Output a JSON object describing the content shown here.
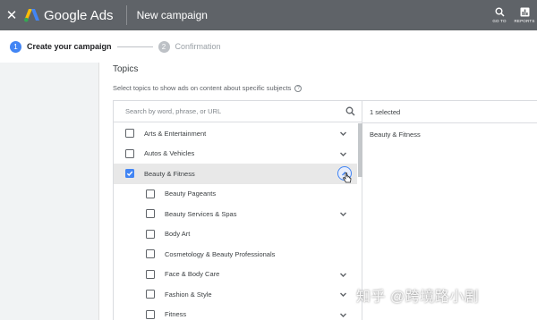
{
  "topbar": {
    "close_icon": "close-icon",
    "brand": "Google Ads",
    "page_title": "New campaign",
    "actions": [
      {
        "icon": "search-icon",
        "label": "GO TO"
      },
      {
        "icon": "bar-chart-icon",
        "label": "REPORTS"
      }
    ]
  },
  "stepper": {
    "steps": [
      {
        "number": "1",
        "label": "Create your campaign",
        "active": true
      },
      {
        "number": "2",
        "label": "Confirmation",
        "active": false
      }
    ]
  },
  "topics": {
    "title": "Topics",
    "description": "Select topics to show ads on content about specific subjects",
    "search_placeholder": "Search by word, phrase, or URL",
    "items": [
      {
        "label": "Arts & Entertainment",
        "checked": false,
        "expandable": true,
        "level": 0
      },
      {
        "label": "Autos & Vehicles",
        "checked": false,
        "expandable": true,
        "level": 0
      },
      {
        "label": "Beauty & Fitness",
        "checked": true,
        "expandable": true,
        "level": 0,
        "expanded": true
      },
      {
        "label": "Beauty Pageants",
        "checked": false,
        "expandable": false,
        "level": 1
      },
      {
        "label": "Beauty Services & Spas",
        "checked": false,
        "expandable": true,
        "level": 1
      },
      {
        "label": "Body Art",
        "checked": false,
        "expandable": false,
        "level": 1
      },
      {
        "label": "Cosmetology & Beauty Professionals",
        "checked": false,
        "expandable": false,
        "level": 1
      },
      {
        "label": "Face & Body Care",
        "checked": false,
        "expandable": true,
        "level": 1
      },
      {
        "label": "Fashion & Style",
        "checked": false,
        "expandable": true,
        "level": 1
      },
      {
        "label": "Fitness",
        "checked": false,
        "expandable": true,
        "level": 1
      }
    ],
    "selected_count": "1 selected",
    "selected_items": [
      "Beauty & Fitness"
    ]
  },
  "watermark": "知乎 @跨境路小剧",
  "colors": {
    "topbar": "#5f6368",
    "accent": "#4285f4",
    "checkbox": "#5f6368"
  }
}
